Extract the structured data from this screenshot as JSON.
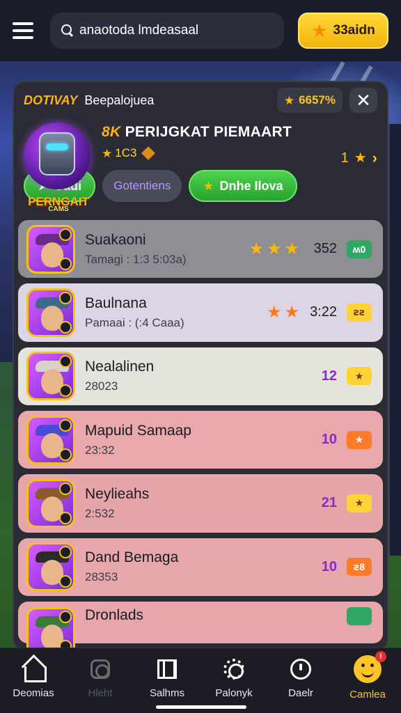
{
  "search": {
    "placeholder": "anaotoda lmdeasaal"
  },
  "coins": {
    "label": "33aidn"
  },
  "panel": {
    "brand": "DOTIVAY",
    "title": "Beepalojuea",
    "rating": "6657%",
    "close": "✕"
  },
  "hero": {
    "logo_text": "PERNGAIT",
    "logo_sub": "CAMS",
    "title_prefix": "8K",
    "title": "PERIJGKAT PIEMAART",
    "rating": "1C3",
    "next_num": "1",
    "buttons": {
      "play": "Gadi",
      "collections": "Gotentiens",
      "more": "Dnhe Ilova"
    }
  },
  "rows": [
    {
      "name": "Suakaoni",
      "sub": "Tamagi : 1:3 5:03a)",
      "stars": 3,
      "score": "352",
      "tag": "ʍ0",
      "tag_style": "green",
      "hat": "#6a2a8a"
    },
    {
      "name": "Baulnana",
      "sub": "Pamaai : (:4 Caaa)",
      "stars": 2,
      "score": "3:22",
      "tag": "ꙅꙅ",
      "tag_style": "yellow",
      "hat": "#3c6a8a"
    },
    {
      "name": "Nealalinen",
      "sub": "28023",
      "stars": 0,
      "score": "12",
      "tag": "★",
      "tag_style": "yellow",
      "hat": "#d8d2c8"
    },
    {
      "name": "Mapuid Samaap",
      "sub": "23:32",
      "stars": 0,
      "score": "10",
      "tag": "★",
      "tag_style": "orange",
      "hat": "#4a4ad8"
    },
    {
      "name": "Neylieahs",
      "sub": "2:532",
      "stars": 0,
      "score": "21",
      "tag": "★",
      "tag_style": "yellow",
      "hat": "#8a5a2a"
    },
    {
      "name": "Dand Bemaga",
      "sub": "28353",
      "stars": 0,
      "score": "10",
      "tag": "ꙅ8",
      "tag_style": "orange",
      "hat": "#2a2a2a"
    },
    {
      "name": "Dronlads",
      "sub": "",
      "stars": 0,
      "score": "",
      "tag": "",
      "tag_style": "green",
      "hat": "#3a7a3a"
    }
  ],
  "nav": [
    {
      "label": "Deomias",
      "icon": "home-icon"
    },
    {
      "label": "Hleht",
      "icon": "camera-icon"
    },
    {
      "label": "Salhms",
      "icon": "map-icon"
    },
    {
      "label": "Palonyk",
      "icon": "gear-icon"
    },
    {
      "label": "Daelr",
      "icon": "chat-icon"
    },
    {
      "label": "Camlea",
      "icon": "profile-icon",
      "badge": "!"
    }
  ],
  "colors": {
    "accent": "#ffc42a",
    "green_button": "#26a32c",
    "panel": "#2a2b35",
    "topbar": "#1a1d2b"
  }
}
